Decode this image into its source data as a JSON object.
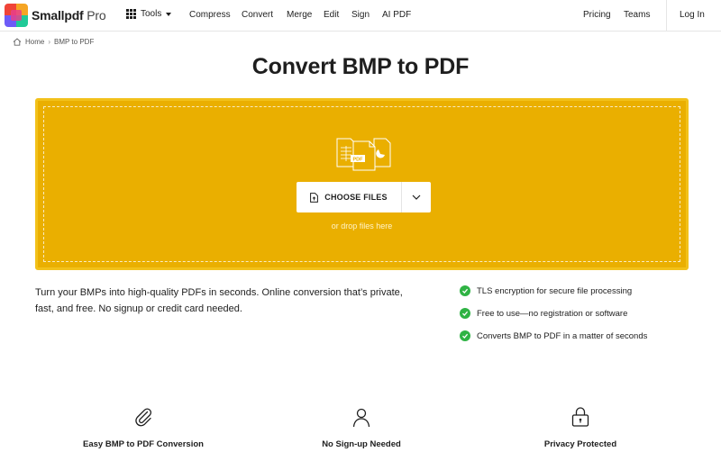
{
  "brand": {
    "name": "Smallpdf",
    "tier": "Pro"
  },
  "nav": {
    "tools_label": "Tools",
    "items": [
      "Compress",
      "Convert",
      "Merge",
      "Edit",
      "Sign",
      "AI PDF"
    ],
    "pricing": "Pricing",
    "teams": "Teams",
    "login": "Log In"
  },
  "breadcrumb": {
    "home": "Home",
    "current": "BMP to PDF"
  },
  "page": {
    "title": "Convert BMP to PDF"
  },
  "dropzone": {
    "choose_label": "CHOOSE FILES",
    "drop_hint": "or drop files here",
    "illustration_badge": "PDF"
  },
  "description": "Turn your BMPs into high-quality PDFs in seconds. Online conversion that’s private, fast, and free. No signup or credit card needed.",
  "features": [
    "TLS encryption for secure file processing",
    "Free to use—no registration or software",
    "Converts BMP to PDF in a matter of seconds"
  ],
  "benefits": [
    {
      "label": "Easy BMP to PDF Conversion",
      "icon": "paperclip-icon"
    },
    {
      "label": "No Sign-up Needed",
      "icon": "user-icon"
    },
    {
      "label": "Privacy Protected",
      "icon": "lock-icon"
    }
  ],
  "colors": {
    "accent_dropzone": "#eaaf00",
    "check_green": "#2fb344",
    "text": "#1e1e1e"
  }
}
